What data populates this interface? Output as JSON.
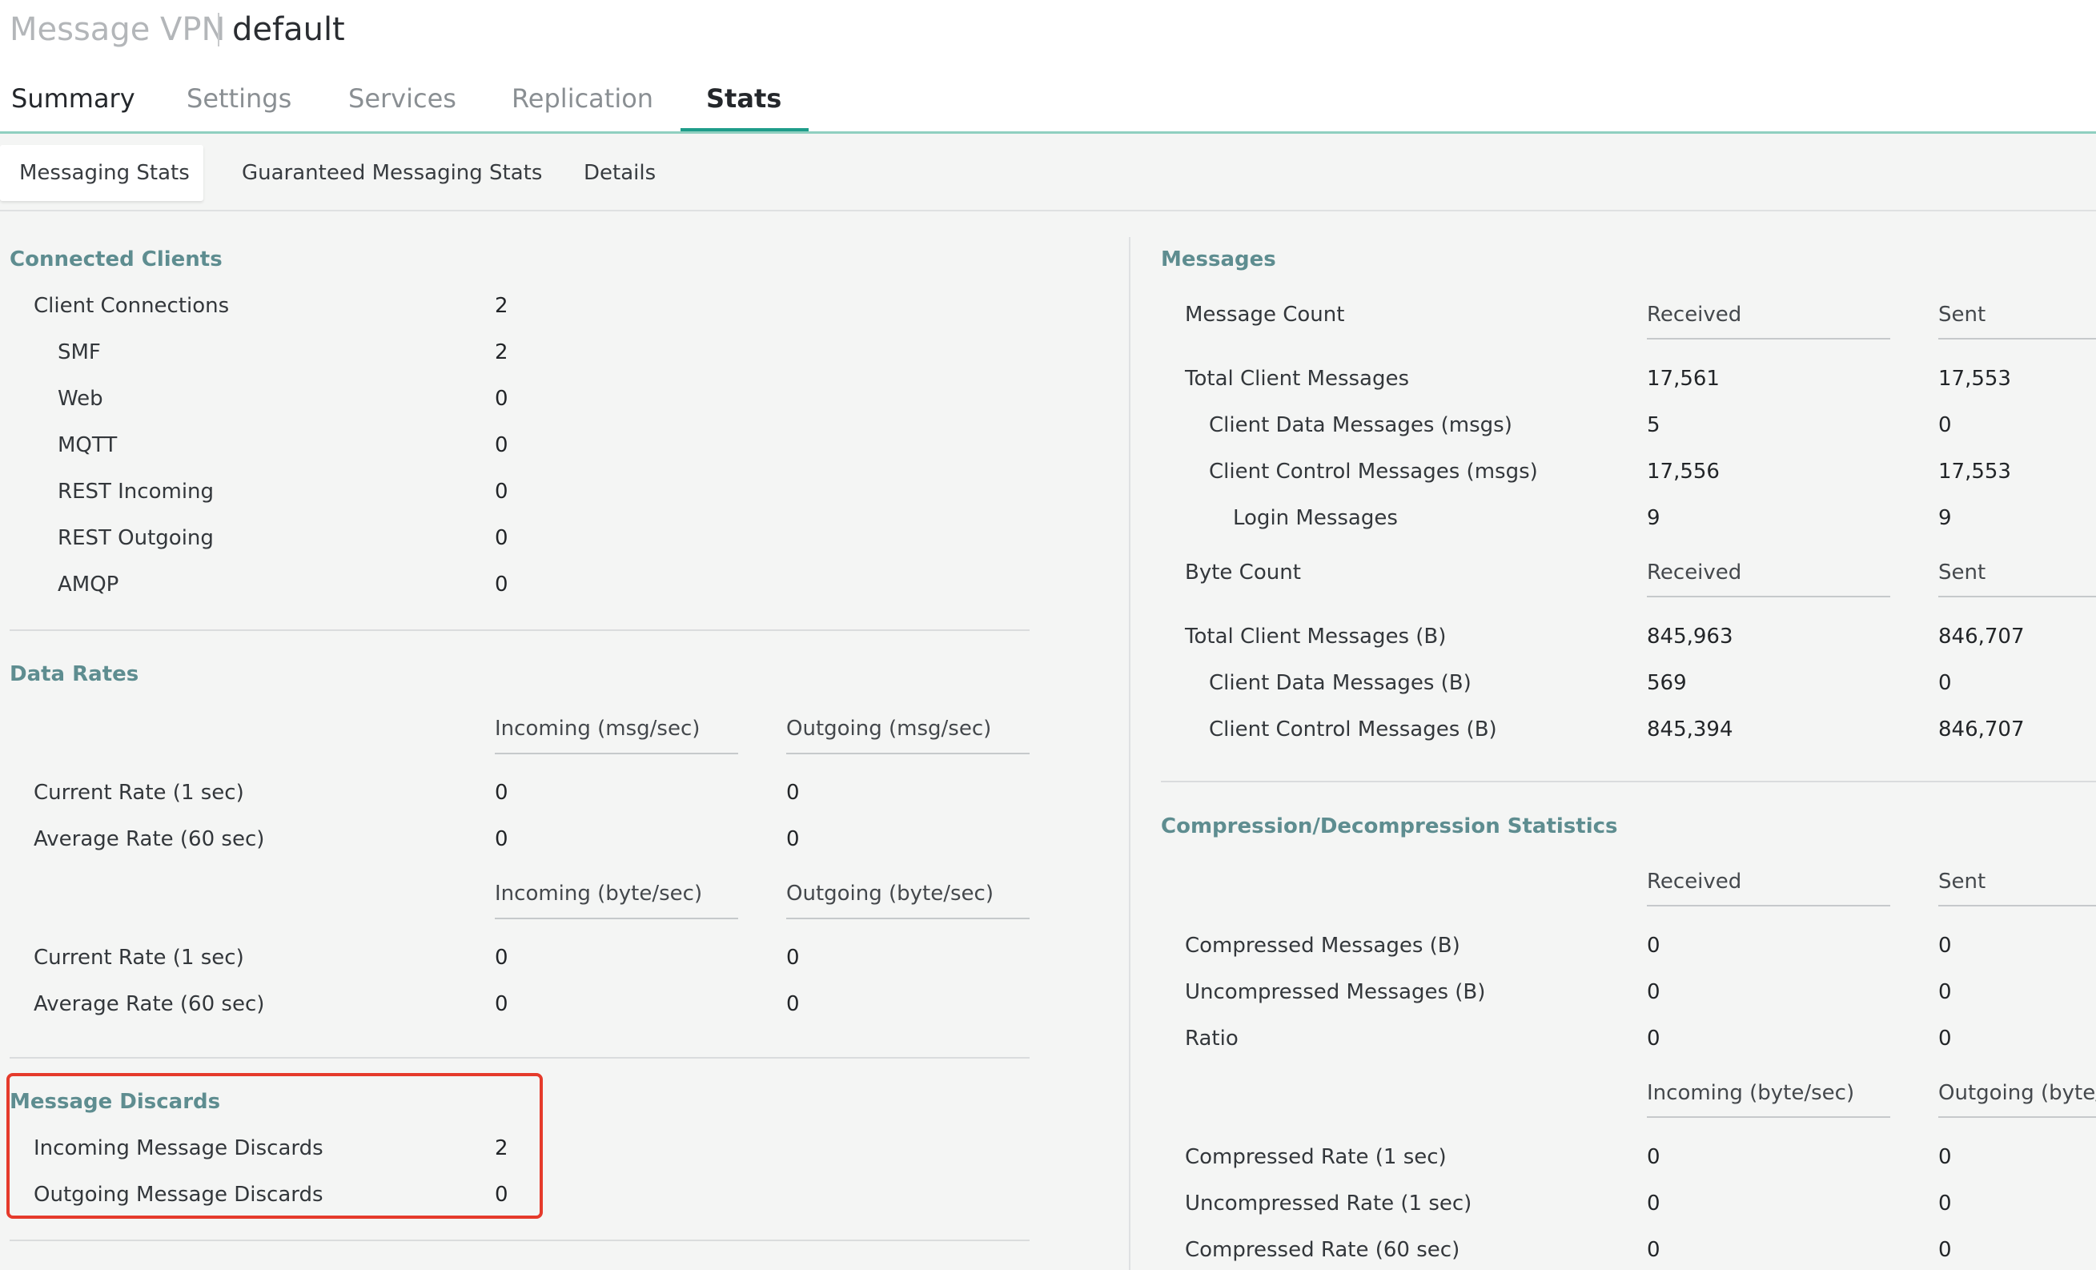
{
  "header": {
    "vpn_label": "Message VPN",
    "vpn_name": "default",
    "tabs": [
      "Summary",
      "Settings",
      "Services",
      "Replication",
      "Stats"
    ],
    "active_tab": "Stats"
  },
  "subtabs": {
    "items": [
      "Messaging Stats",
      "Guaranteed Messaging Stats",
      "Details"
    ],
    "active": "Messaging Stats"
  },
  "connected_clients": {
    "title": "Connected Clients",
    "rows": [
      {
        "label": "Client Connections",
        "value": "2"
      },
      {
        "label": "SMF",
        "value": "2"
      },
      {
        "label": "Web",
        "value": "0"
      },
      {
        "label": "MQTT",
        "value": "0"
      },
      {
        "label": "REST Incoming",
        "value": "0"
      },
      {
        "label": "REST Outgoing",
        "value": "0"
      },
      {
        "label": "AMQP",
        "value": "0"
      }
    ]
  },
  "data_rates": {
    "title": "Data Rates",
    "msg_headers": [
      "Incoming (msg/sec)",
      "Outgoing (msg/sec)"
    ],
    "msg_rows": [
      {
        "label": "Current Rate (1 sec)",
        "in": "0",
        "out": "0"
      },
      {
        "label": "Average Rate (60 sec)",
        "in": "0",
        "out": "0"
      }
    ],
    "byte_headers": [
      "Incoming (byte/sec)",
      "Outgoing (byte/sec)"
    ],
    "byte_rows": [
      {
        "label": "Current Rate (1 sec)",
        "in": "0",
        "out": "0"
      },
      {
        "label": "Average Rate (60 sec)",
        "in": "0",
        "out": "0"
      }
    ]
  },
  "message_discards": {
    "title": "Message Discards",
    "rows": [
      {
        "label": "Incoming Message Discards",
        "value": "2"
      },
      {
        "label": "Outgoing Message Discards",
        "value": "0"
      }
    ],
    "highlight_color": "#e53a2b"
  },
  "messages": {
    "title": "Messages",
    "count_header": {
      "label": "Message Count",
      "received": "Received",
      "sent": "Sent"
    },
    "count_rows": [
      {
        "label": "Total Client Messages",
        "received": "17,561",
        "sent": "17,553"
      },
      {
        "label": "Client Data Messages (msgs)",
        "received": "5",
        "sent": "0"
      },
      {
        "label": "Client Control Messages (msgs)",
        "received": "17,556",
        "sent": "17,553"
      },
      {
        "label": "Login Messages",
        "received": "9",
        "sent": "9"
      }
    ],
    "byte_header": {
      "label": "Byte Count",
      "received": "Received",
      "sent": "Sent"
    },
    "byte_rows": [
      {
        "label": "Total Client Messages (B)",
        "received": "845,963",
        "sent": "846,707"
      },
      {
        "label": "Client Data Messages (B)",
        "received": "569",
        "sent": "0"
      },
      {
        "label": "Client Control Messages (B)",
        "received": "845,394",
        "sent": "846,707"
      }
    ]
  },
  "compression": {
    "title": "Compression/Decompression Statistics",
    "headers": [
      "Received",
      "Sent"
    ],
    "rows": [
      {
        "label": "Compressed Messages (B)",
        "received": "0",
        "sent": "0"
      },
      {
        "label": "Uncompressed Messages (B)",
        "received": "0",
        "sent": "0"
      },
      {
        "label": "Ratio",
        "received": "0",
        "sent": "0"
      }
    ],
    "rate_headers": [
      "Incoming (byte/sec)",
      "Outgoing (byte/s"
    ],
    "rate_rows": [
      {
        "label": "Compressed Rate (1 sec)",
        "in": "0",
        "out": "0"
      },
      {
        "label": "Uncompressed Rate (1 sec)",
        "in": "0",
        "out": "0"
      },
      {
        "label": "Compressed Rate (60 sec)",
        "in": "0",
        "out": "0"
      }
    ]
  },
  "colors": {
    "accent": "#1e9d8a",
    "section_title": "#5e8d90",
    "background": "#f4f5f4"
  }
}
